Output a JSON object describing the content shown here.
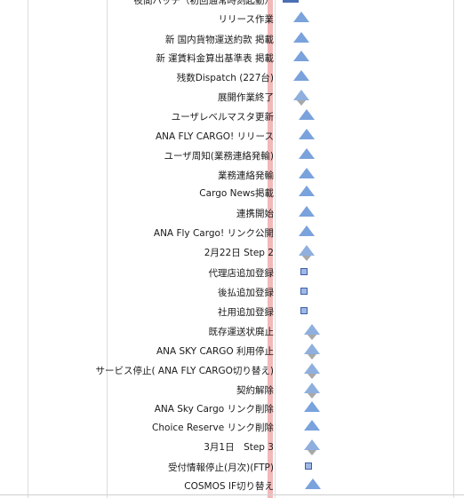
{
  "gantt": {
    "tasks": [
      {
        "label": "夜間バッチ（初回通常時刻起動）",
        "marker": "bar"
      },
      {
        "label": "リリース作業",
        "marker": "triangle"
      },
      {
        "label": "新 国内貨物運送約款 掲載",
        "marker": "triangle"
      },
      {
        "label": "新 運賃料金算出基準表 掲載",
        "marker": "triangle"
      },
      {
        "label": "残数Dispatch (227台)",
        "marker": "triangle"
      },
      {
        "label": "展開作業終了",
        "marker": "triangle-gray"
      },
      {
        "label": "ユーザレベルマスタ更新",
        "marker": "triangle"
      },
      {
        "label": "ANA FLY CARGO! リリース",
        "marker": "triangle"
      },
      {
        "label": "ユーザ周知(業務連絡発輸)",
        "marker": "triangle"
      },
      {
        "label": "業務連絡発輸",
        "marker": "triangle"
      },
      {
        "label": "Cargo News掲載",
        "marker": "triangle"
      },
      {
        "label": "連携開始",
        "marker": "triangle"
      },
      {
        "label": "ANA Fly Cargo! リンク公開",
        "marker": "triangle"
      },
      {
        "label": "2月22日 Step 2",
        "marker": "triangle-gray"
      },
      {
        "label": "代理店追加登録",
        "marker": "square"
      },
      {
        "label": "後払追加登録",
        "marker": "square"
      },
      {
        "label": "社用追加登録",
        "marker": "square"
      },
      {
        "label": "既存運送状廃止",
        "marker": "triangle-gray"
      },
      {
        "label": "ANA SKY CARGO 利用停止",
        "marker": "triangle-gray"
      },
      {
        "label": "サービス停止( ANA FLY CARGO切り替え)",
        "marker": "triangle-gray"
      },
      {
        "label": "契約解除",
        "marker": "triangle-gray"
      },
      {
        "label": "ANA Sky Cargo リンク削除",
        "marker": "triangle"
      },
      {
        "label": "Choice Reserve リンク削除",
        "marker": "triangle"
      },
      {
        "label": "3月1日　Step 3",
        "marker": "triangle-gray"
      },
      {
        "label": "受付情報停止(月次)(FTP)",
        "marker": "square"
      },
      {
        "label": "COSMOS IF切り替え",
        "marker": "triangle"
      }
    ]
  },
  "colors": {
    "today_line": "#f1b9b9",
    "milestone": "#7aa2dc",
    "grid": "#dcdcdc"
  }
}
